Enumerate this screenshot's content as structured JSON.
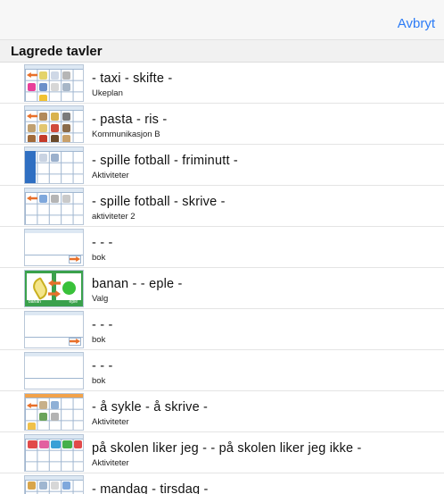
{
  "header": {
    "cancel_label": "Avbryt"
  },
  "section": {
    "title": "Lagrede tavler"
  },
  "boards": [
    {
      "title": "- taxi - skifte -",
      "subtitle": "Ukeplan"
    },
    {
      "title": "- pasta - ris -",
      "subtitle": "Kommunikasjon B"
    },
    {
      "title": "- spille fotball - friminutt -",
      "subtitle": "Aktiviteter"
    },
    {
      "title": "- spille fotball - skrive -",
      "subtitle": "aktiviteter 2"
    },
    {
      "title": "- - -",
      "subtitle": "bok"
    },
    {
      "title": "banan - - eple -",
      "subtitle": "Valg",
      "thumb_labels": [
        "banan",
        "eple"
      ]
    },
    {
      "title": "- - -",
      "subtitle": "bok"
    },
    {
      "title": "- - -",
      "subtitle": "bok"
    },
    {
      "title": "- å sykle - å skrive -",
      "subtitle": "Aktiviteter"
    },
    {
      "title": "på skolen liker jeg - - på skolen liker jeg ikke -",
      "subtitle": "Aktiviteter"
    },
    {
      "title": "- mandag - tirsdag -",
      "subtitle": ""
    }
  ],
  "colors": {
    "accent": "#2d7cf6",
    "symbol_grid": "#2f6fc2",
    "valg_green": "#3aa14c"
  }
}
